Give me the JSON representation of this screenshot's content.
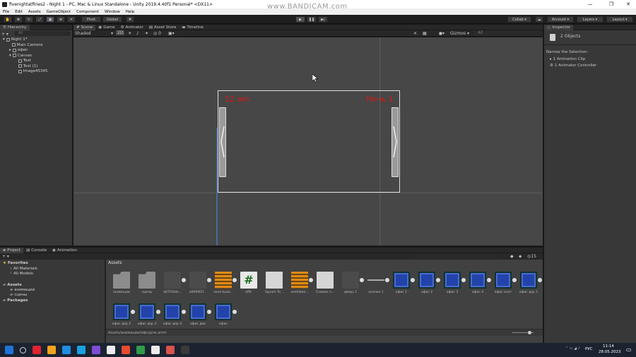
{
  "window": {
    "title": "fivenightatfiries2 - Night 1 - PC, Mac & Linux Standalone - Unity 2019.4.40f1 Personal* <DX11>",
    "minimize": "—",
    "maximize": "❐",
    "close": "✕"
  },
  "watermark": "www.BANDICAM.com",
  "menu": [
    "File",
    "Edit",
    "Assets",
    "GameObject",
    "Component",
    "Window",
    "Help"
  ],
  "toolbar": {
    "pivot": "Pivot",
    "global": "Global",
    "collab": "Collab ▾",
    "account": "Account ▾",
    "layers": "Layers ▾",
    "layout": "Layout ▾"
  },
  "hierarchy": {
    "tab": "Hierarchy",
    "search": "All",
    "items": [
      {
        "label": "Night 1*",
        "indent": 0,
        "arrow": "▾"
      },
      {
        "label": "Main Camera",
        "indent": 1,
        "arrow": ""
      },
      {
        "label": "офис",
        "indent": 1,
        "arrow": "▸"
      },
      {
        "label": "Canvas",
        "indent": 1,
        "arrow": "▾"
      },
      {
        "label": "Text",
        "indent": 2,
        "arrow": ""
      },
      {
        "label": "Text (1)",
        "indent": 2,
        "arrow": ""
      },
      {
        "label": "Image45345",
        "indent": 2,
        "arrow": ""
      }
    ]
  },
  "scene": {
    "tabs": [
      "Scene",
      "Game",
      "Animator",
      "Asset Store",
      "Timeline"
    ],
    "shading": "Shaded",
    "mode2d": "2D",
    "gizmos": "Gizmos ▾",
    "search": "All",
    "text_left": "12 am",
    "text_right": "Ночь 1"
  },
  "inspector": {
    "tab": "Inspector",
    "objects": "2 Objects",
    "narrow": "Narrow the Selection:",
    "items": [
      "1 Animation Clip",
      "1 Animator Controller"
    ]
  },
  "project": {
    "tabs": [
      "Project",
      "Console",
      "Animation"
    ],
    "tree": [
      {
        "label": "Favorites",
        "type": "star",
        "indent": 0
      },
      {
        "label": "All Materials",
        "type": "search",
        "indent": 1
      },
      {
        "label": "All Models",
        "type": "search",
        "indent": 1
      },
      {
        "label": "Assets",
        "type": "folder",
        "indent": 0
      },
      {
        "label": "анимации",
        "type": "folder",
        "indent": 1
      },
      {
        "label": "сцены",
        "type": "folder",
        "indent": 1
      },
      {
        "label": "Packages",
        "type": "folder",
        "indent": 0
      }
    ],
    "breadcrumb": "Assets",
    "badge": "15",
    "assets_row1": [
      {
        "label": "анимации",
        "kind": "folder"
      },
      {
        "label": "сцены",
        "kind": "folder"
      },
      {
        "label": "a67f34de...",
        "kind": "dark"
      },
      {
        "label": "a9090f2f...",
        "kind": "dark"
      },
      {
        "label": "neon-buzz...",
        "kind": "orange"
      },
      {
        "label": "offic",
        "kind": "green"
      },
      {
        "label": "Square Te...",
        "kind": "white"
      },
      {
        "label": "ventilator...",
        "kind": "orange"
      },
      {
        "label": "Снимок э...",
        "kind": "white"
      },
      {
        "label": "дверь 1",
        "kind": "dark"
      },
      {
        "label": "кнопка 1",
        "kind": "line"
      },
      {
        "label": "офис 1",
        "kind": "blue"
      },
      {
        "label": "офис 2",
        "kind": "blue"
      },
      {
        "label": "офис 3",
        "kind": "blue"
      },
      {
        "label": "офис 4",
        "kind": "blue"
      },
      {
        "label": "офис анот",
        "kind": "blue"
      },
      {
        "label": "офис дор 1",
        "kind": "blue"
      }
    ],
    "assets_row2": [
      {
        "label": "офис дор 2",
        "kind": "blue"
      },
      {
        "label": "офис дор 3",
        "kind": "blue"
      },
      {
        "label": "офис дор 4",
        "kind": "blue"
      },
      {
        "label": "офис дик",
        "kind": "blue"
      },
      {
        "label": "офис",
        "kind": "blue"
      }
    ],
    "status_path": "Assets/анимации/офкурпк.anim"
  },
  "taskbar": {
    "lang": "РУС",
    "time": "11:14",
    "date": "28.05.2023",
    "icons": [
      "windows-icon",
      "search-icon",
      "record-icon",
      "app-icon",
      "vscode-icon",
      "app2-icon",
      "vs-icon",
      "unity-icon",
      "chrome-icon",
      "chrome2-icon",
      "unity2-icon",
      "app3-icon",
      "terminal-icon"
    ]
  }
}
